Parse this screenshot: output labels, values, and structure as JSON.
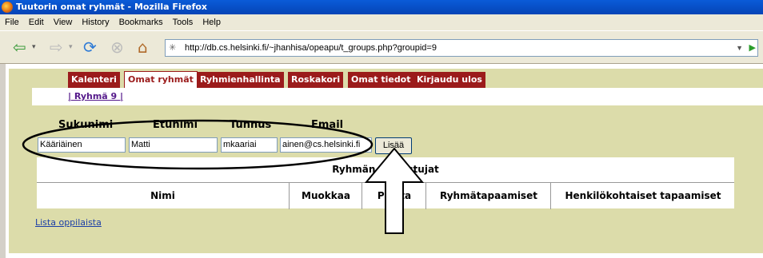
{
  "window": {
    "title": "Tuutorin omat ryhmät - Mozilla Firefox"
  },
  "menu": [
    "File",
    "Edit",
    "View",
    "History",
    "Bookmarks",
    "Tools",
    "Help"
  ],
  "url": "http://db.cs.helsinki.fi/~jhanhisa/opeapu/t_groups.php?groupid=9",
  "tabs": [
    "Kalenteri",
    "Omat ryhmät",
    "Ryhmienhallinta",
    "Roskakori",
    "Omat tiedot",
    "Kirjaudu ulos"
  ],
  "group_link": "| Ryhmä 9 |",
  "form": {
    "labels": [
      "Sukunimi",
      "Etunimi",
      "Tunnus",
      "Email"
    ],
    "values": [
      "Kääriäinen",
      "Matti",
      "mkaariai",
      "ainen@cs.helsinki.fi"
    ],
    "add_button": "Lisää"
  },
  "table": {
    "caption": "Ryhmän osallistujat",
    "headers": [
      "Nimi",
      "Muokkaa",
      "Poista",
      "Ryhmätapaamiset",
      "Henkilökohtaiset tapaamiset"
    ]
  },
  "student_list_link": "Lista oppilaista"
}
